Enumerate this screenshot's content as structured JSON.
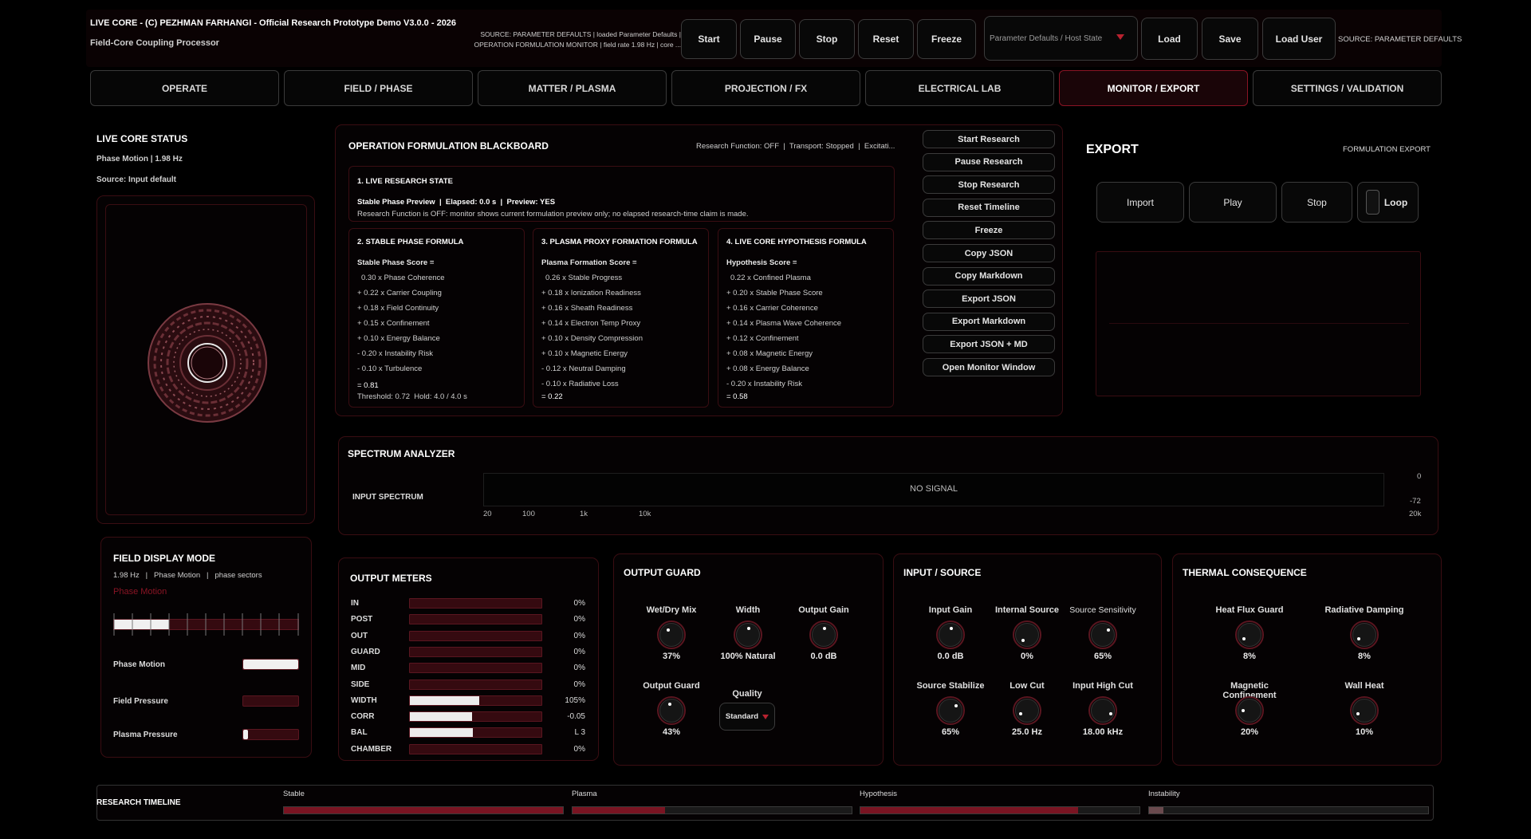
{
  "header": {
    "title": "LIVE CORE - (C) PEZHMAN FARHANGI - Official Research Prototype Demo V3.0.0 - 2026",
    "subtitle": "Field-Core Coupling Processor",
    "source_line1": "SOURCE: PARAMETER DEFAULTS  |  loaded Parameter Defaults  |",
    "source_line2": "OPERATION FORMULATION MONITOR  |  field rate 1.98 Hz  |  core ...",
    "buttons": [
      "Start",
      "Pause",
      "Stop",
      "Reset",
      "Freeze"
    ],
    "preset": "Parameter Defaults / Host State",
    "load": "Load",
    "save": "Save",
    "load_user": "Load User",
    "source_right": "SOURCE: PARAMETER DEFAULTS"
  },
  "tabs": [
    "OPERATE",
    "FIELD / PHASE",
    "MATTER / PLASMA",
    "PROJECTION / FX",
    "ELECTRICAL LAB",
    "MONITOR / EXPORT",
    "SETTINGS / VALIDATION"
  ],
  "status": {
    "title": "LIVE CORE STATUS",
    "line1": "Phase Motion  |  1.98 Hz",
    "line2": "Source: Input default"
  },
  "blackboard": {
    "title": "OPERATION FORMULATION BLACKBOARD",
    "status": "Research Function: OFF  |  Transport: Stopped  |  Excitati...",
    "live": {
      "title": "1. LIVE RESEARCH STATE",
      "line1": "Stable Phase Preview  |  Elapsed: 0.0 s  |  Preview: YES",
      "line2": "Research Function is OFF: monitor shows current formulation preview only; no elapsed research-time claim is made."
    },
    "cards": [
      {
        "title": "2. STABLE PHASE FORMULA",
        "head": "Stable Phase Score =",
        "lines": [
          "0.30 x Phase Coherence",
          "+ 0.22 x Carrier Coupling",
          "+ 0.18 x Field Continuity",
          "+ 0.15 x Confinement",
          "+ 0.10 x Energy Balance",
          "- 0.20 x Instability Risk",
          "- 0.10 x Turbulence"
        ],
        "result": "= 0.81",
        "extra": "Threshold: 0.72  Hold: 4.0 / 4.0 s"
      },
      {
        "title": "3. PLASMA PROXY FORMATION FORMULA",
        "head": "Plasma Formation Score =",
        "lines": [
          "0.26 x Stable Progress",
          "+ 0.18 x Ionization Readiness",
          "+ 0.16 x Sheath Readiness",
          "+ 0.14 x Electron Temp Proxy",
          "+ 0.10 x Density Compression",
          "+ 0.10 x Magnetic Energy",
          "- 0.12 x Neutral Damping",
          "- 0.10 x Radiative Loss"
        ],
        "result": "= 0.22",
        "extra": ""
      },
      {
        "title": "4. LIVE CORE HYPOTHESIS FORMULA",
        "head": "Hypothesis Score =",
        "lines": [
          "0.22 x Confined Plasma",
          "+ 0.20 x Stable Phase Score",
          "+ 0.16 x Carrier Coherence",
          "+ 0.14 x Plasma Wave Coherence",
          "+ 0.12 x Confinement",
          "+ 0.08 x Magnetic Energy",
          "+ 0.08 x Energy Balance",
          "- 0.20 x Instability Risk"
        ],
        "result": "= 0.58",
        "extra": ""
      }
    ],
    "actions": [
      "Start Research",
      "Pause Research",
      "Stop Research",
      "Reset Timeline",
      "Freeze",
      "Copy JSON",
      "Copy Markdown",
      "Export JSON",
      "Export Markdown",
      "Export JSON + MD",
      "Open Monitor Window"
    ]
  },
  "export": {
    "title": "EXPORT",
    "sub": "FORMULATION EXPORT",
    "buttons": [
      "Import",
      "Play",
      "Stop",
      "Loop"
    ]
  },
  "spectrum": {
    "title": "SPECTRUM ANALYZER",
    "label": "INPUT SPECTRUM",
    "signal": "NO SIGNAL",
    "ticks": [
      "20",
      "100",
      "1k",
      "10k",
      "20k"
    ],
    "db_top": "0",
    "db_bottom": "-72"
  },
  "field_display": {
    "title": "FIELD DISPLAY MODE",
    "info": "1.98 Hz   |   Phase Motion   |   phase sectors",
    "mode": "Phase Motion",
    "rows": [
      {
        "label": "Phase Motion",
        "value": 1.0
      },
      {
        "label": "Field Pressure",
        "value": 0.0
      },
      {
        "label": "Plasma Pressure",
        "value": 0.08
      }
    ],
    "sector_fill": 0.3
  },
  "meters": {
    "title": "OUTPUT METERS",
    "rows": [
      {
        "label": "IN",
        "value": "0%",
        "fill": 0
      },
      {
        "label": "POST",
        "value": "0%",
        "fill": 0
      },
      {
        "label": "OUT",
        "value": "0%",
        "fill": 0
      },
      {
        "label": "GUARD",
        "value": "0%",
        "fill": 0
      },
      {
        "label": "MID",
        "value": "0%",
        "fill": 0
      },
      {
        "label": "SIDE",
        "value": "0%",
        "fill": 0
      },
      {
        "label": "WIDTH",
        "value": "105%",
        "fill": 0.53
      },
      {
        "label": "CORR",
        "value": "-0.05",
        "fill": 0.47
      },
      {
        "label": "BAL",
        "value": "L 3",
        "fill": 0.48
      },
      {
        "label": "CHAMBER",
        "value": "0%",
        "fill": 0
      }
    ]
  },
  "output_guard": {
    "title": "OUTPUT GUARD",
    "knobs": [
      {
        "label": "Wet/Dry Mix",
        "value": "37%",
        "level": 0.37
      },
      {
        "label": "Width",
        "value": "100% Natural",
        "level": 0.5
      },
      {
        "label": "Output Gain",
        "value": "0.0 dB",
        "level": 0.5
      },
      {
        "label": "Output Guard",
        "value": "43%",
        "level": 0.43
      }
    ],
    "quality_label": "Quality",
    "quality": "Standard"
  },
  "input_source": {
    "title": "INPUT / SOURCE",
    "knobs": [
      {
        "label": "Input Gain",
        "value": "0.0 dB",
        "level": 0.5
      },
      {
        "label": "Internal Source",
        "value": "0%",
        "level": 0
      },
      {
        "label": "Source Sensitivity",
        "value": "65%",
        "level": 0.65
      },
      {
        "label": "Source Stabilize",
        "value": "65%",
        "level": 0.65
      },
      {
        "label": "Low Cut",
        "value": "25.0 Hz",
        "level": 0.1
      },
      {
        "label": "Input High Cut",
        "value": "18.00 kHz",
        "level": 0.9
      }
    ]
  },
  "thermal": {
    "title": "THERMAL CONSEQUENCE",
    "knobs": [
      {
        "label": "Heat Flux Guard",
        "value": "8%",
        "level": 0.08
      },
      {
        "label": "Radiative Damping",
        "value": "8%",
        "level": 0.08
      },
      {
        "label": "Magnetic Confinement",
        "value": "20%",
        "level": 0.2
      },
      {
        "label": "Wall Heat",
        "value": "10%",
        "level": 0.1
      }
    ]
  },
  "timeline": {
    "title": "RESEARCH TIMELINE",
    "items": [
      {
        "label": "Stable",
        "fill": 1.0
      },
      {
        "label": "Plasma",
        "fill": 0.33
      },
      {
        "label": "Hypothesis",
        "fill": 0.78
      },
      {
        "label": "Instability",
        "fill": 0.05
      }
    ]
  },
  "colors": {
    "accent": "#8a1424",
    "bg": "#000000"
  }
}
